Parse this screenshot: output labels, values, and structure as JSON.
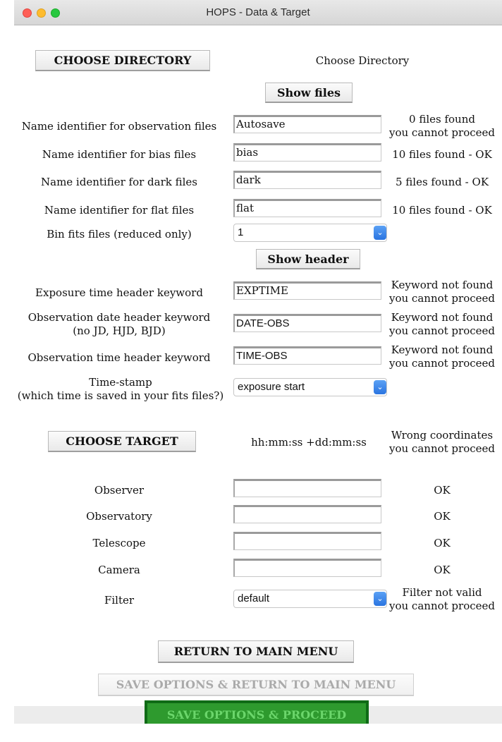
{
  "window": {
    "title": "HOPS - Data & Target"
  },
  "directory": {
    "button_label": "CHOOSE DIRECTORY",
    "path_label": "Choose Directory",
    "show_files_label": "Show files"
  },
  "files": [
    {
      "label": "Name identifier for observation files",
      "value": "Autosave",
      "status": [
        "0 files found",
        "you cannot proceed"
      ]
    },
    {
      "label": "Name identifier for bias files",
      "value": "bias",
      "status": [
        "10 files found - OK"
      ]
    },
    {
      "label": "Name identifier for dark files",
      "value": "dark",
      "status": [
        "5 files found - OK"
      ]
    },
    {
      "label": "Name identifier for flat files",
      "value": "flat",
      "status": [
        "10 files found - OK"
      ]
    }
  ],
  "bin": {
    "label": "Bin fits files (reduced only)",
    "value": "1"
  },
  "header": {
    "show_header_label": "Show header"
  },
  "keywords": [
    {
      "label": [
        "Exposure time header keyword"
      ],
      "value": "EXPTIME",
      "status": [
        "Keyword not found",
        "you cannot proceed"
      ]
    },
    {
      "label": [
        "Observation date header keyword",
        "(no JD, HJD, BJD)"
      ],
      "value": "DATE-OBS",
      "status": [
        "Keyword not found",
        "you cannot proceed"
      ]
    },
    {
      "label": [
        "Observation time header keyword"
      ],
      "value": "TIME-OBS",
      "status": [
        "Keyword not found",
        "you cannot proceed"
      ]
    }
  ],
  "timestamp": {
    "label": [
      "Time-stamp",
      "(which time is saved in your fits files?)"
    ],
    "value": "exposure start"
  },
  "target": {
    "button_label": "CHOOSE TARGET",
    "coord_format": "hh:mm:ss +dd:mm:ss",
    "status": [
      "Wrong coordinates",
      "you cannot proceed"
    ]
  },
  "observation": [
    {
      "label": "Observer",
      "value": "",
      "status": "OK"
    },
    {
      "label": "Observatory",
      "value": "",
      "status": "OK"
    },
    {
      "label": "Telescope",
      "value": "",
      "status": "OK"
    },
    {
      "label": "Camera",
      "value": "",
      "status": "OK"
    }
  ],
  "filter": {
    "label": "Filter",
    "value": "default",
    "status": [
      "Filter not valid",
      "you cannot proceed"
    ]
  },
  "actions": {
    "return_label": "RETURN TO MAIN MENU",
    "save_return_label": "SAVE OPTIONS & RETURN TO MAIN MENU",
    "save_proceed_label": "SAVE OPTIONS & PROCEED"
  },
  "colors": {
    "accent_select": "#2a74e0",
    "proceed_green": "#2e9a2e",
    "proceed_border": "#0f6b16"
  }
}
